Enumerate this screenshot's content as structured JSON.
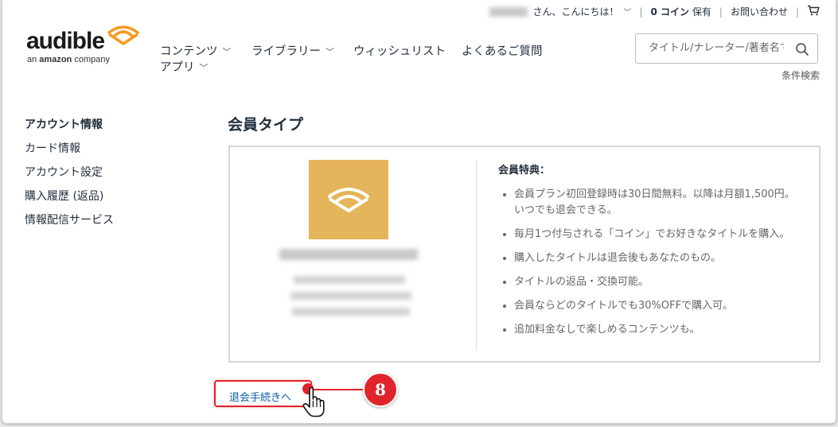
{
  "header": {
    "greeting": "さん、こんにちは！",
    "coins": "0 コイン",
    "coins_suffix": "保有",
    "contact": "お問い合わせ",
    "cart_icon": "cart-icon"
  },
  "logo": {
    "word": "audible",
    "sub_prefix": "an ",
    "sub_brand": "amazon",
    "sub_suffix": " company"
  },
  "nav": {
    "items": [
      {
        "label": "コンテンツ",
        "dropdown": true
      },
      {
        "label": "ライブラリー",
        "dropdown": true
      },
      {
        "label": "ウィッシュリスト",
        "dropdown": false
      },
      {
        "label": "よくあるご質問",
        "dropdown": false
      },
      {
        "label": "アプリ",
        "dropdown": true
      }
    ]
  },
  "search": {
    "placeholder": "タイトル/ナレーター/著者名で",
    "advanced": "条件検索"
  },
  "sidebar": {
    "items": [
      {
        "label": "アカウント情報",
        "active": true
      },
      {
        "label": "カード情報",
        "active": false
      },
      {
        "label": "アカウント設定",
        "active": false
      },
      {
        "label": "購入履歴 (返品)",
        "active": false
      },
      {
        "label": "情報配信サービス",
        "active": false
      }
    ]
  },
  "main": {
    "title": "会員タイプ",
    "benefits_heading": "会員特典：",
    "benefits": [
      "会員プラン初回登録時は30日間無料。以降は月額1,500円。いつでも退会できる。",
      "毎月1つ付与される「コイン」でお好きなタイトルを購入。",
      "購入したタイトルは退会後もあなたのもの。",
      "タイトルの返品・交換可能。",
      "会員ならどのタイトルでも30%OFFで購入可。",
      "追加料金なしで楽しめるコンテンツも。"
    ]
  },
  "cancel": {
    "label": "退会手続きへ",
    "step_number": "8"
  },
  "colors": {
    "accent": "#e0242b",
    "plan_tile": "#e4b55a",
    "link": "#0a5ea8",
    "logo_orange": "#f7991c"
  }
}
